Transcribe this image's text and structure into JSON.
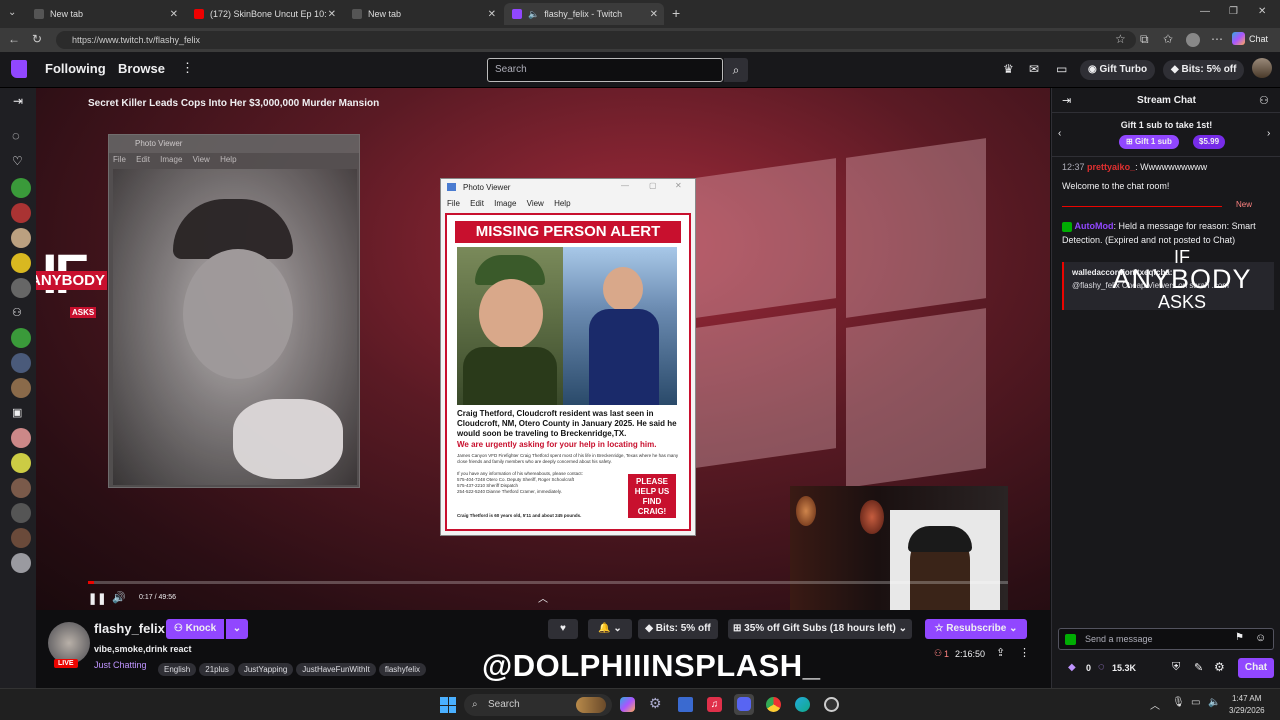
{
  "browser": {
    "tabs": [
      {
        "title": "New tab",
        "active": false
      },
      {
        "title": "(172) SkinBone Uncut Ep 10: Blue H",
        "active": false
      },
      {
        "title": "New tab",
        "active": false
      },
      {
        "title": "flashy_felix - Twitch",
        "active": true
      }
    ],
    "url": "https://www.twitch.tv/flashy_felix",
    "chat_label": "Chat"
  },
  "nav": {
    "following": "Following",
    "browse": "Browse",
    "search_placeholder": "Search",
    "gift_turbo": "Gift Turbo",
    "bits": "Bits: 5% off"
  },
  "player": {
    "title": "Secret Killer Leads Cops Into Her $3,000,000 Murder Mansion",
    "time": "0:17 / 49:56",
    "progress": 0.006,
    "bg_window_title": "Photo Viewer",
    "bg_menu": [
      "File",
      "Edit",
      "Image",
      "View",
      "Help"
    ],
    "photo_window_title": "Photo Viewer",
    "photo_menu": [
      "File",
      "Edit",
      "Image",
      "View",
      "Help"
    ],
    "poster": {
      "headline": "MISSING PERSON ALERT",
      "body": "Craig Thetford, Cloudcroft resident was last seen in Cloudcroft, NM, Otero County in January 2025. He said he would soon be traveling to Breckenridge,TX.",
      "urgent": "We are urgently asking for your help in locating him.",
      "fineprint": "James Canyon VFD Firefighter Craig Thetford spent most of his life in Breckenridge, Texas where he has many close friends and family members who are deeply concerned about his safety.",
      "contact_lines": [
        "If you have any information of his whereabouts, please contact:",
        "575-404-7248 Otero Co. Deputy Sheriff, Roger Schoolcraft",
        "575-437-2210 Sheriff Dispatch",
        "254-522-5240 Dianne Thetford Cramer, immediately."
      ],
      "description": "Craig Thetford is 60 years old, 5'11 and about 245 pounds.",
      "cta": "PLEASE HELP US FIND CRAIG!"
    },
    "logo_top": "IF",
    "logo_mid": "ANYBODY",
    "logo_bot": "ASKS"
  },
  "channel": {
    "name": "flashy_felix",
    "title": "vibe,smoke,drink react",
    "category": "Just Chatting",
    "live": "LIVE",
    "tags": [
      "English",
      "21plus",
      "JustYapping",
      "JustHaveFunWithIt",
      "flashyfelix"
    ],
    "knock": "Knock",
    "bits": "Bits: 5% off",
    "gift_subs": "35% off Gift Subs (18 hours left)",
    "resubscribe": "Resubscribe",
    "viewers": "1",
    "uptime": "2:16:50",
    "watermark": "@DOLPHIIINSPLASH_"
  },
  "chat": {
    "header": "Stream Chat",
    "gift_banner": "Gift  1 sub to take 1st!",
    "gift_btn": "Gift 1 sub",
    "gift_price": "$5.99",
    "messages": [
      {
        "time": "12:37",
        "user": "prettyaiko_",
        "text": "Wwwwwwwwww"
      },
      {
        "time": "",
        "user": "",
        "text": "Welcome to the chat room!"
      }
    ],
    "new_label": "New",
    "automod_user": "AutoMod",
    "automod_text": "Held a message for reason: Smart Detection. (Expired and not posted to Chat)",
    "held_user": "walledaccordionltxeqfcba:",
    "held_text": "@flashy_felix Cheap Viewers on sarah .com",
    "overlay_top": "IF",
    "overlay_mid": "ANYBODY",
    "overlay_bot": "ASKS",
    "input_placeholder": "Send a message",
    "points_left": "0",
    "points": "15.3K",
    "chat_btn": "Chat"
  },
  "taskbar": {
    "search": "Search",
    "time": "1:47 AM",
    "date": "3/29/2026"
  },
  "colors": {
    "twitch_purple": "#9147ff",
    "live_red": "#eb0400",
    "poster_red": "#c8102e"
  }
}
